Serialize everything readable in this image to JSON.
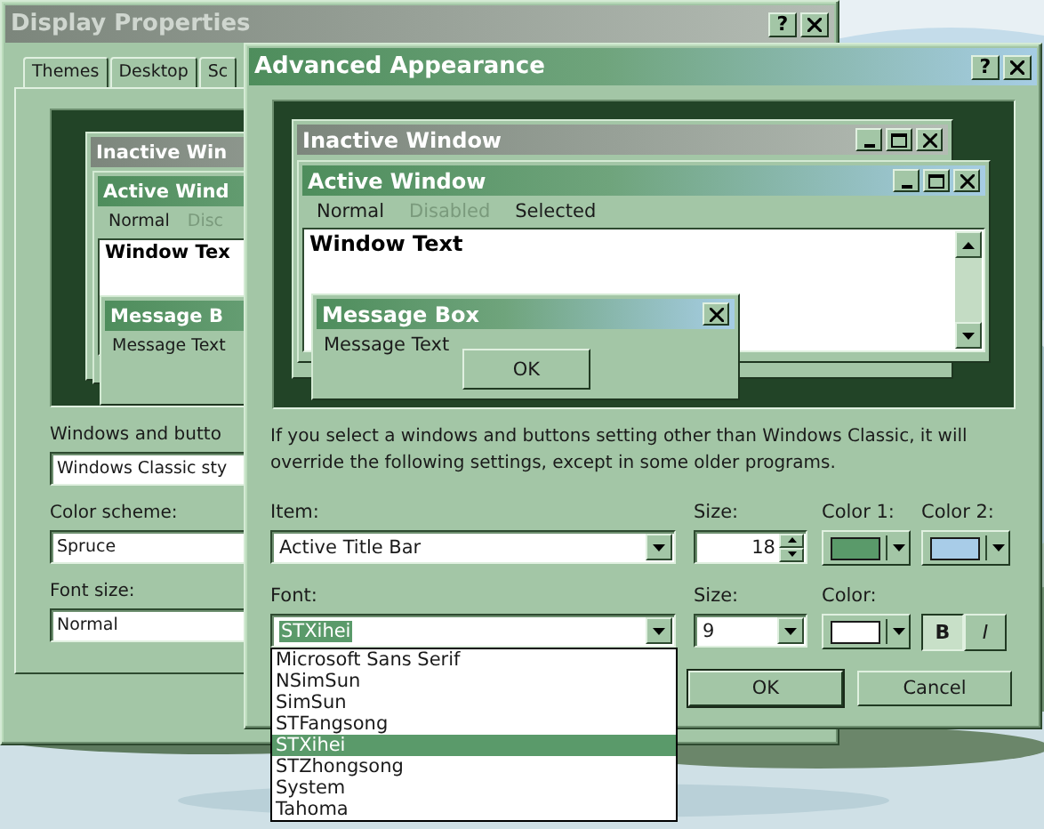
{
  "display_properties": {
    "title": "Display Properties",
    "caption_buttons": [
      "?"
    ],
    "tabs": [
      {
        "label": "Themes",
        "selected": false
      },
      {
        "label": "Desktop",
        "selected": false
      },
      {
        "label": "Sc",
        "selected": false
      }
    ],
    "preview": {
      "inactive_title": "Inactive Win",
      "active_title": "Active Wind",
      "menu": [
        {
          "label": "Normal",
          "disabled": false
        },
        {
          "label": "Disc",
          "disabled": true
        }
      ],
      "window_text": "Window Tex",
      "message_title": "Message B",
      "message_text": "Message Text"
    },
    "fields": [
      {
        "label": "Windows and butto",
        "value": "Windows Classic sty"
      },
      {
        "label": "Color scheme:",
        "value": "Spruce"
      },
      {
        "label": "Font size:",
        "value": "Normal"
      }
    ]
  },
  "advanced_appearance": {
    "title": "Advanced Appearance",
    "caption_buttons": [
      "?"
    ],
    "preview": {
      "inactive_title": "Inactive Window",
      "active_title": "Active Window",
      "menu": [
        {
          "label": "Normal",
          "disabled": false
        },
        {
          "label": "Disabled",
          "disabled": true
        },
        {
          "label": "Selected",
          "disabled": false
        }
      ],
      "window_text": "Window Text",
      "message_title": "Message Box",
      "message_text": "Message Text",
      "message_button": "OK"
    },
    "description": "If you select a windows and buttons setting other than Windows Classic, it will override the following settings, except in some older programs.",
    "item": {
      "label": "Item:",
      "value": "Active Title Bar"
    },
    "item_size": {
      "label": "Size:",
      "value": "18"
    },
    "color_1": {
      "label": "Color 1:",
      "color": "#5a9a6a"
    },
    "color_2": {
      "label": "Color 2:",
      "color": "#a8cce8"
    },
    "font": {
      "label": "Font:",
      "value": "STXihei",
      "options": [
        {
          "label": "Microsoft Sans Serif",
          "selected": false
        },
        {
          "label": "NSimSun",
          "selected": false
        },
        {
          "label": "SimSun",
          "selected": false
        },
        {
          "label": "STFangsong",
          "selected": false
        },
        {
          "label": "STXihei",
          "selected": true
        },
        {
          "label": "STZhongsong",
          "selected": false
        },
        {
          "label": "System",
          "selected": false
        },
        {
          "label": "Tahoma",
          "selected": false
        }
      ]
    },
    "font_size": {
      "label": "Size:",
      "value": "9"
    },
    "font_color": {
      "label": "Color:",
      "color": "#ffffff"
    },
    "style_buttons": [
      {
        "label": "B",
        "kind": "bold",
        "pressed": true
      },
      {
        "label": "I",
        "kind": "italic",
        "pressed": false
      }
    ],
    "buttons": [
      {
        "label": "OK",
        "default": true
      },
      {
        "label": "Cancel",
        "default": false
      }
    ]
  }
}
